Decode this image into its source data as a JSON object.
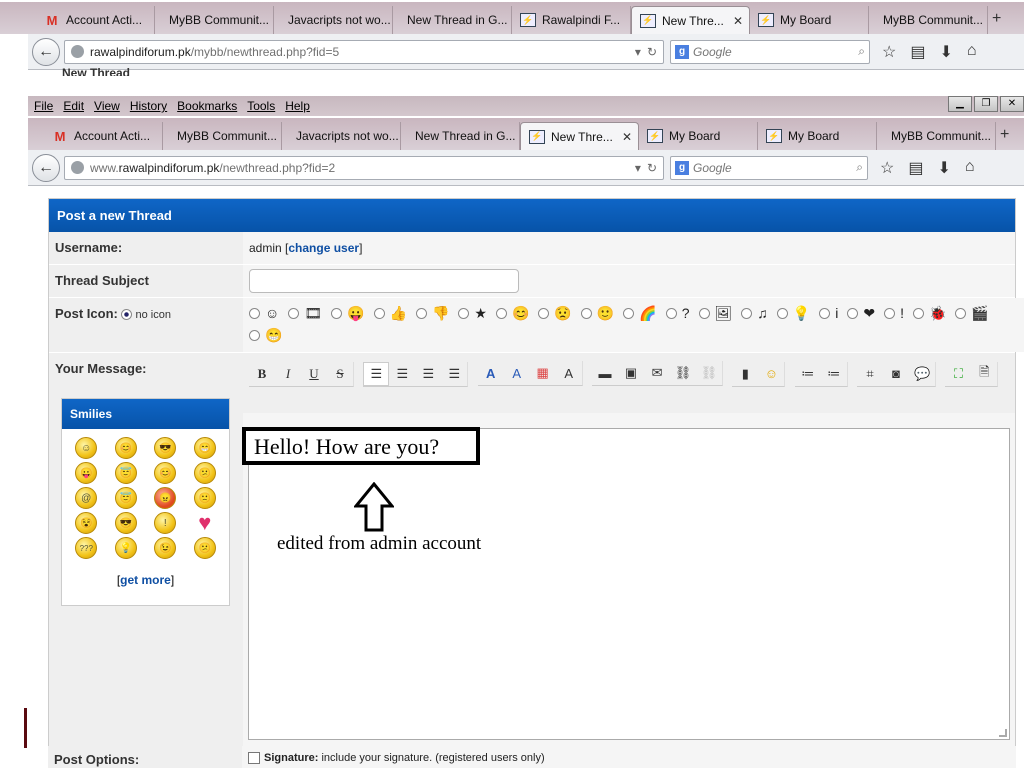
{
  "browser_back": {
    "tabs": [
      {
        "label": "Account Acti...",
        "favicon": "gmail"
      },
      {
        "label": "MyBB Communit...",
        "favicon": "none"
      },
      {
        "label": "Javacripts not wo...",
        "favicon": "none"
      },
      {
        "label": "New Thread in G...",
        "favicon": "none"
      },
      {
        "label": "Rawalpindi F...",
        "favicon": "mybb"
      },
      {
        "label": "New Thre...",
        "favicon": "mybb",
        "active": true
      },
      {
        "label": "My Board",
        "favicon": "mybb"
      },
      {
        "label": "MyBB Communit...",
        "favicon": "none"
      }
    ],
    "url_domain": "rawalpindiforum.pk",
    "url_path": "/mybb/newthread.php?fid=5",
    "search_placeholder": "Google",
    "cut_text": "New Thread"
  },
  "menu": [
    "File",
    "Edit",
    "View",
    "History",
    "Bookmarks",
    "Tools",
    "Help"
  ],
  "browser_front": {
    "tabs": [
      {
        "label": "Account Acti...",
        "favicon": "gmail"
      },
      {
        "label": "MyBB Communit...",
        "favicon": "none"
      },
      {
        "label": "Javacripts not wo...",
        "favicon": "none"
      },
      {
        "label": "New Thread in G...",
        "favicon": "none"
      },
      {
        "label": "New Thre...",
        "favicon": "mybb",
        "active": true
      },
      {
        "label": "My Board",
        "favicon": "mybb"
      },
      {
        "label": "My Board",
        "favicon": "mybb"
      },
      {
        "label": "MyBB Communit...",
        "favicon": "none"
      }
    ],
    "url_prefix": "www.",
    "url_domain": "rawalpindiforum.pk",
    "url_path": "/newthread.php?fid=2",
    "search_placeholder": "Google"
  },
  "form": {
    "title": "Post a new Thread",
    "username_label": "Username:",
    "username_value": "admin",
    "change_user": "change user",
    "subject_label": "Thread Subject",
    "subject_value": "",
    "post_icon_label": "Post Icon:",
    "no_icon": "no icon",
    "post_icons": [
      "☺",
      "🎞",
      "😛",
      "👍",
      "👎",
      "★",
      "😊",
      "😟",
      "🙂",
      "🌈",
      "?",
      "🖼",
      "♫",
      "💡",
      "i",
      "❤",
      "!",
      "🐞",
      "🎬",
      "😁"
    ],
    "message_label": "Your Message:",
    "editor_text": "Hello! How are you?",
    "annotation": "edited from admin account",
    "post_options_label": "Post Options:",
    "signature_label": "Signature:",
    "signature_desc": "include your signature. (registered users only)"
  },
  "smilies": {
    "title": "Smilies",
    "items": [
      "☺",
      "😊",
      "😎",
      "😁",
      "😛",
      "😇",
      "😊",
      "😕",
      "@",
      "😇",
      "😠",
      "🙁",
      "😵",
      "😎",
      "!",
      "♥",
      "???",
      "💡",
      "😉",
      "😕"
    ],
    "get_more": "get more"
  },
  "colors": {
    "header_blue": "#0753a8",
    "link": "#0f4fa3",
    "label_bg": "#efefef"
  }
}
